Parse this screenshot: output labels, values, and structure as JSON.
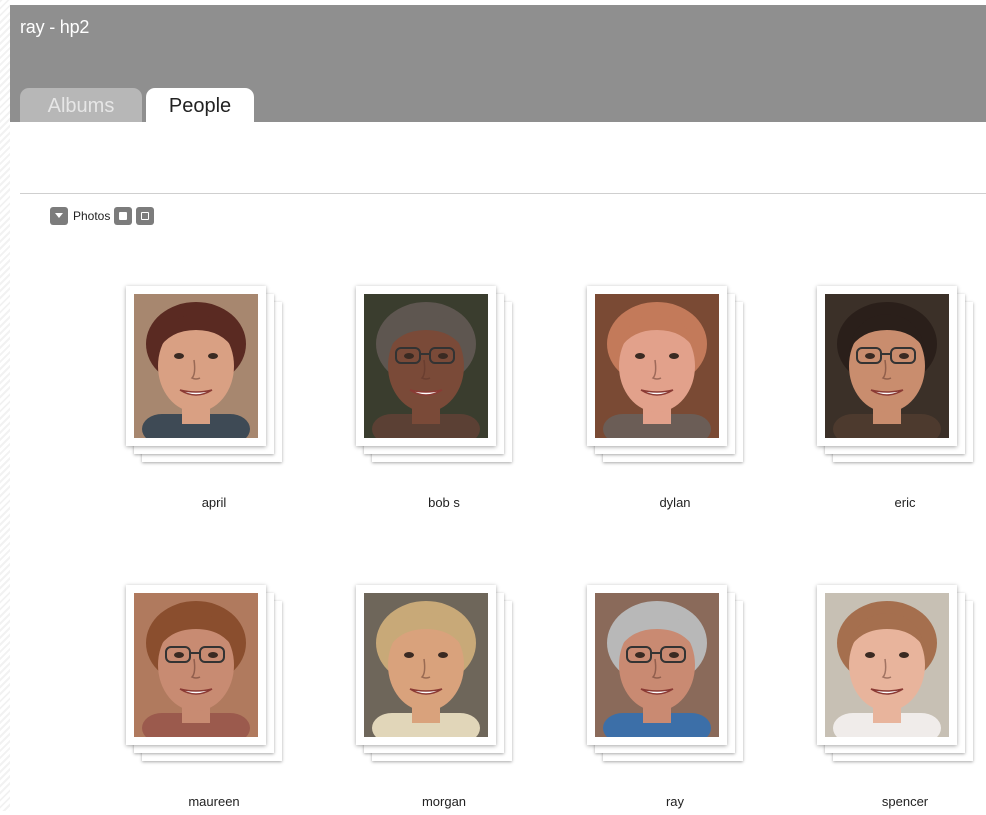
{
  "window": {
    "title": "ray - hp2"
  },
  "tabs": [
    {
      "label": "Albums",
      "active": false
    },
    {
      "label": "People",
      "active": true
    }
  ],
  "toolbar": {
    "label": "Photos",
    "icons": [
      "dropdown-arrow-icon",
      "single-view-icon",
      "grid-view-icon"
    ]
  },
  "people": [
    {
      "name": "april",
      "skin": "#d9a083",
      "hair": "#5a2a22",
      "bg": "#a7876f",
      "shirt": "#3e4a55",
      "glasses": false
    },
    {
      "name": "bob s",
      "skin": "#7a4a38",
      "hair": "#5e5650",
      "bg": "#3a3d2e",
      "shirt": "#5b4034",
      "glasses": true
    },
    {
      "name": "dylan",
      "skin": "#e2a18b",
      "hair": "#c37a5a",
      "bg": "#7a4a34",
      "shirt": "#6b5d56",
      "glasses": false
    },
    {
      "name": "eric",
      "skin": "#c98d6e",
      "hair": "#2a1f1a",
      "bg": "#3b3028",
      "shirt": "#4d3a2e",
      "glasses": true
    },
    {
      "name": "maureen",
      "skin": "#c88b72",
      "hair": "#8a4e2e",
      "bg": "#b07a5e",
      "shirt": "#9b5a4d",
      "glasses": true
    },
    {
      "name": "morgan",
      "skin": "#d9a27c",
      "hair": "#c8a978",
      "bg": "#6e665a",
      "shirt": "#e1d6b9",
      "glasses": false
    },
    {
      "name": "ray",
      "skin": "#c98a72",
      "hair": "#b8b8b8",
      "bg": "#8a6a5a",
      "shirt": "#3c6fa8",
      "glasses": true
    },
    {
      "name": "spencer",
      "skin": "#e8b49c",
      "hair": "#a56f4e",
      "bg": "#c7c0b4",
      "shirt": "#f0ecea",
      "glasses": false
    }
  ]
}
